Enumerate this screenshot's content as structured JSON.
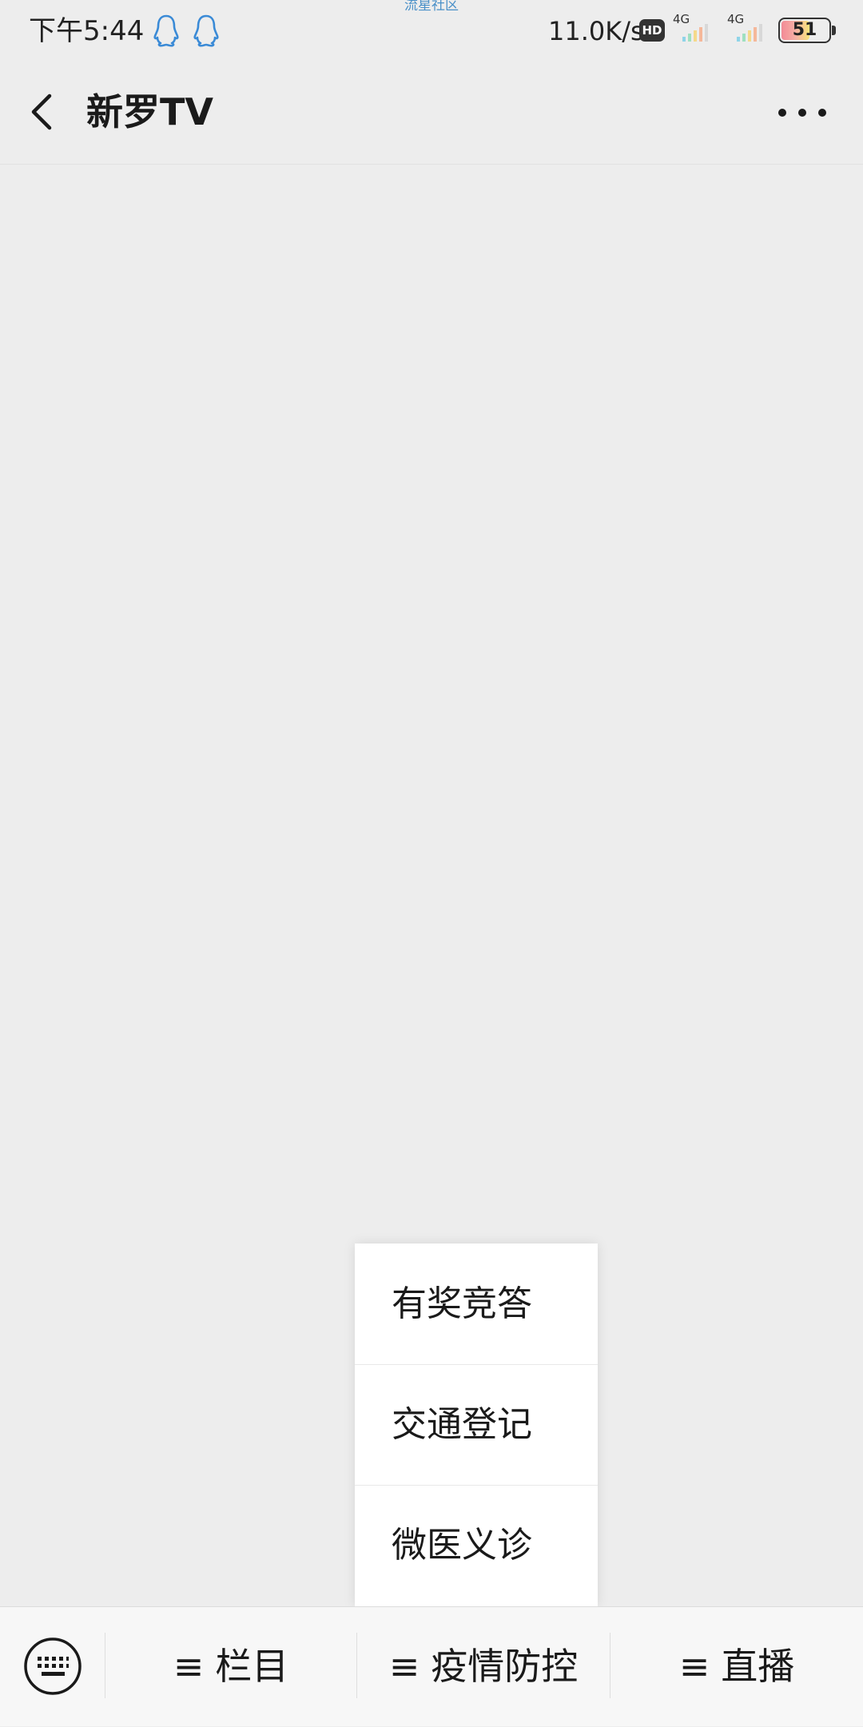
{
  "status_bar": {
    "time": "下午5:44",
    "watermark": "流星社区",
    "net_speed": "11.0K/s",
    "hd_badge": "HD",
    "signal_1_label": "4G",
    "signal_2_label": "4G",
    "battery_level": "51",
    "icons": [
      "qq-icon",
      "qq-icon",
      "hd-icon",
      "signal-icon",
      "signal-icon",
      "battery-icon"
    ]
  },
  "header": {
    "title": "新罗TV",
    "back_icon": "chevron-left-icon",
    "more_icon": "more-dots-icon"
  },
  "popup_menu": {
    "items": [
      {
        "label": "有奖竞答"
      },
      {
        "label": "交通登记"
      },
      {
        "label": "微医义诊"
      }
    ]
  },
  "bottom_menu": {
    "keyboard_icon": "keyboard-icon",
    "items": [
      {
        "glyph": "≡",
        "label": "栏目"
      },
      {
        "glyph": "≡",
        "label": "疫情防控"
      },
      {
        "glyph": "≡",
        "label": "直播"
      }
    ]
  },
  "colors": {
    "background": "#ededed",
    "status_icon_blue": "#3a8ad6",
    "watermark_blue": "#4a90c8",
    "popup_background": "#ffffff",
    "bottom_bar_background": "#f7f7f7"
  }
}
